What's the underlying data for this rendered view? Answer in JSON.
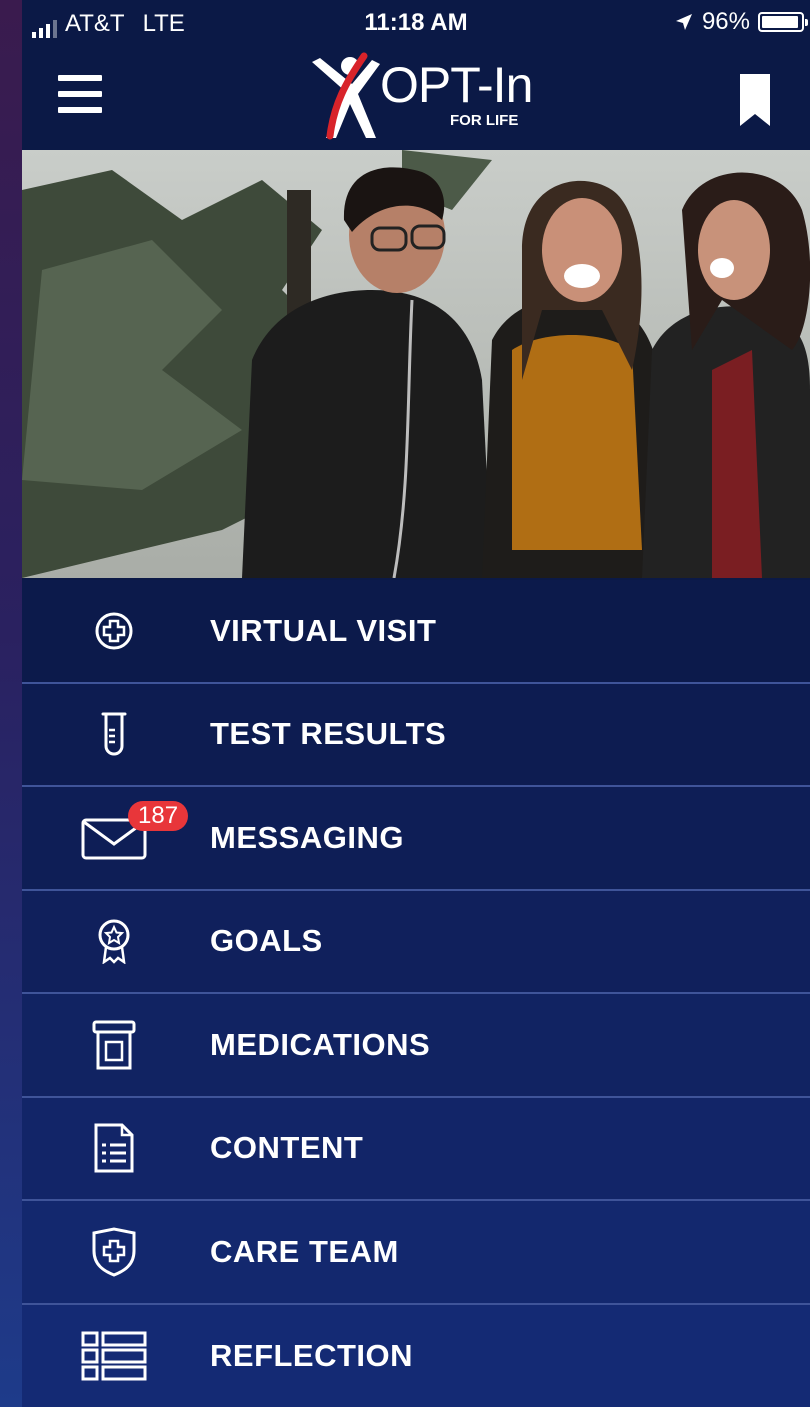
{
  "status_bar": {
    "carrier": "AT&T",
    "network": "LTE",
    "time": "11:18 AM",
    "battery_percent": "96%",
    "battery_level": 0.96
  },
  "header": {
    "logo_text": "OPT-In",
    "logo_subtext": "FOR LIFE",
    "menu_icon": "hamburger-menu-icon",
    "bookmark_icon": "bookmark-icon"
  },
  "hero": {
    "image": "hero-photo-three-friends-laughing-outdoors"
  },
  "menu": {
    "items": [
      {
        "label": "VIRTUAL VISIT",
        "icon": "medical-cross-circle-icon"
      },
      {
        "label": "TEST RESULTS",
        "icon": "test-tube-icon"
      },
      {
        "label": "MESSAGING",
        "icon": "envelope-icon",
        "badge": "187"
      },
      {
        "label": "GOALS",
        "icon": "award-ribbon-icon"
      },
      {
        "label": "MEDICATIONS",
        "icon": "pill-bottle-icon"
      },
      {
        "label": "CONTENT",
        "icon": "document-list-icon"
      },
      {
        "label": "CARE TEAM",
        "icon": "shield-cross-icon"
      },
      {
        "label": "REFLECTION",
        "icon": "list-layout-icon"
      }
    ]
  },
  "colors": {
    "header_bg": "#0b1946",
    "menu_border": "#3f5499",
    "badge": "#e8363a",
    "logo_accent": "#d8232a"
  }
}
